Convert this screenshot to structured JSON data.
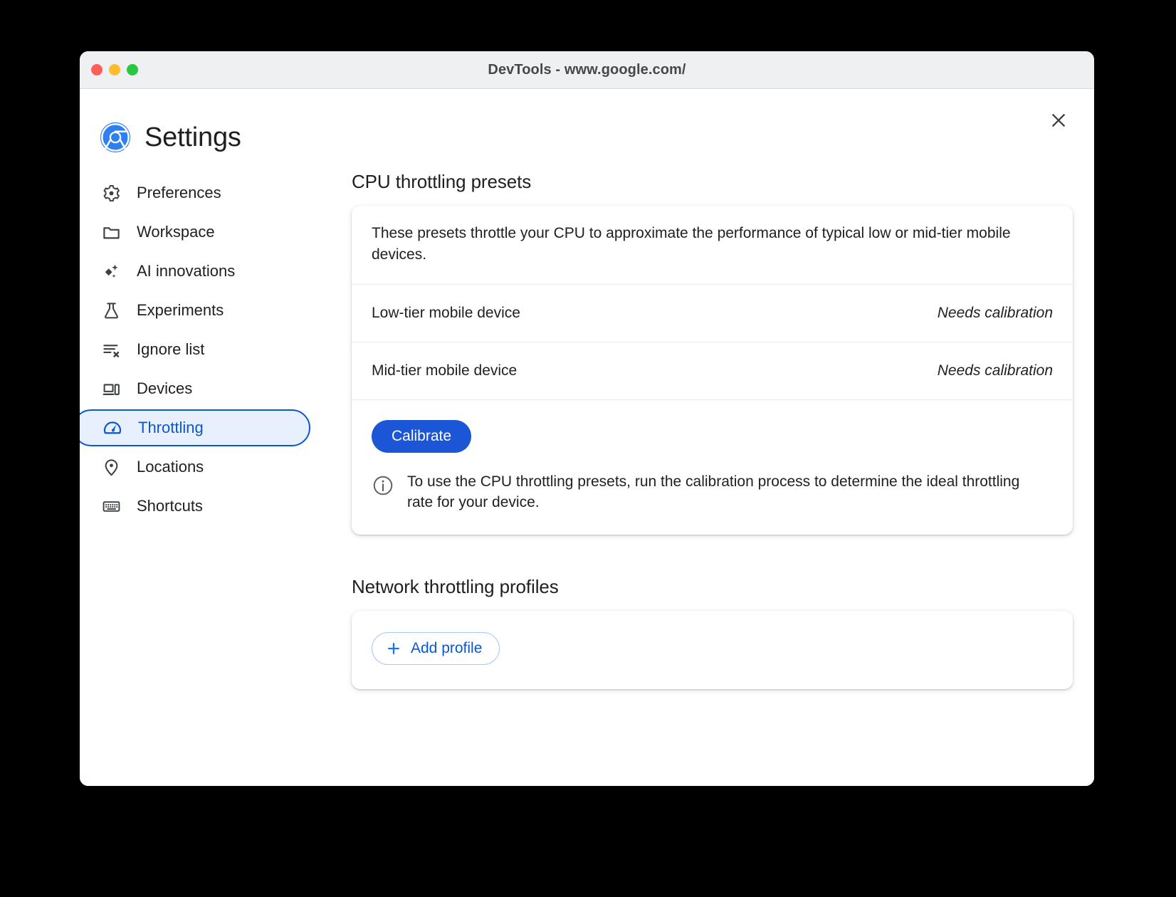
{
  "window": {
    "title": "DevTools - www.google.com/",
    "traffic_lights": [
      "close",
      "minimize",
      "zoom"
    ],
    "close_icon": "close-icon"
  },
  "header": {
    "title": "Settings",
    "logo_icon": "chrome-logo-icon"
  },
  "sidebar": {
    "items": [
      {
        "label": "Preferences",
        "icon": "gear-icon",
        "selected": false
      },
      {
        "label": "Workspace",
        "icon": "folder-icon",
        "selected": false
      },
      {
        "label": "AI innovations",
        "icon": "sparkle-icon",
        "selected": false
      },
      {
        "label": "Experiments",
        "icon": "flask-icon",
        "selected": false
      },
      {
        "label": "Ignore list",
        "icon": "list-x-icon",
        "selected": false
      },
      {
        "label": "Devices",
        "icon": "devices-icon",
        "selected": false
      },
      {
        "label": "Throttling",
        "icon": "speedometer-icon",
        "selected": true
      },
      {
        "label": "Locations",
        "icon": "location-pin-icon",
        "selected": false
      },
      {
        "label": "Shortcuts",
        "icon": "keyboard-icon",
        "selected": false
      }
    ]
  },
  "main": {
    "cpu_section": {
      "title": "CPU throttling presets",
      "intro": "These presets throttle your CPU to approximate the performance of typical low or mid-tier mobile devices.",
      "presets": [
        {
          "name": "Low-tier mobile device",
          "status": "Needs calibration"
        },
        {
          "name": "Mid-tier mobile device",
          "status": "Needs calibration"
        }
      ],
      "calibrate_label": "Calibrate",
      "info_icon": "info-icon",
      "info_text": "To use the CPU throttling presets, run the calibration process to determine the ideal throttling rate for your device."
    },
    "network_section": {
      "title": "Network throttling profiles",
      "add_profile_label": "Add profile",
      "add_profile_icon": "plus-icon"
    }
  },
  "colors": {
    "accent_blue": "#0b57d0",
    "button_blue": "#1a56d6",
    "selected_bg": "#e8f0fe",
    "outline_blue": "#a8c7fa",
    "text_primary": "#1f1f1f",
    "titlebar_bg": "#eff0f1",
    "page_bg": "#000000"
  }
}
